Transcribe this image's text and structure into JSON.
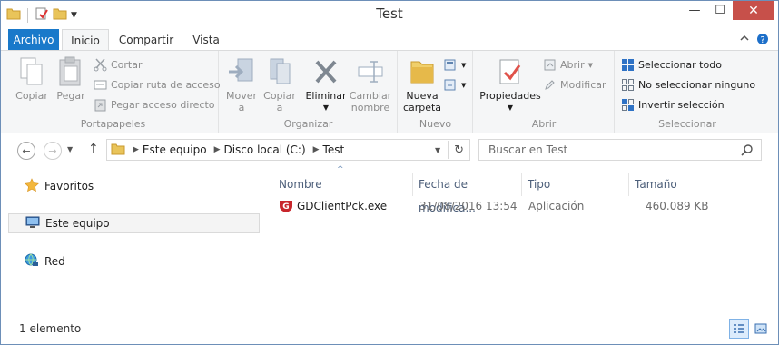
{
  "window": {
    "title": "Test"
  },
  "ribbon_tabs": [
    {
      "label": "Archivo"
    },
    {
      "label": "Inicio"
    },
    {
      "label": "Compartir"
    },
    {
      "label": "Vista"
    }
  ],
  "ribbon": {
    "portapapeles": {
      "label": "Portapapeles",
      "copiar": "Copiar",
      "pegar": "Pegar",
      "cortar": "Cortar",
      "copiar_ruta": "Copiar ruta de acceso",
      "pegar_acceso": "Pegar acceso directo"
    },
    "organizar": {
      "label": "Organizar",
      "mover_a": "Mover",
      "mover_a2": "a",
      "copiar_a": "Copiar",
      "copiar_a2": "a",
      "eliminar": "Eliminar",
      "cambiar": "Cambiar",
      "nombre": "nombre"
    },
    "nuevo": {
      "label": "Nuevo",
      "nueva": "Nueva",
      "carpeta": "carpeta"
    },
    "abrir": {
      "label": "Abrir",
      "propiedades": "Propiedades",
      "abrir": "Abrir",
      "modificar": "Modificar"
    },
    "seleccionar": {
      "label": "Seleccionar",
      "todo": "Seleccionar todo",
      "ninguno": "No seleccionar ninguno",
      "invertir": "Invertir selección"
    }
  },
  "address": {
    "crumbs": [
      "Este equipo",
      "Disco local (C:)",
      "Test"
    ]
  },
  "search": {
    "placeholder": "Buscar en Test"
  },
  "nav_pane": {
    "items": [
      {
        "label": "Favoritos"
      },
      {
        "label": "Este equipo"
      },
      {
        "label": "Red"
      }
    ]
  },
  "columns": {
    "name": "Nombre",
    "date": "Fecha de modifica...",
    "type": "Tipo",
    "size": "Tamaño"
  },
  "files": [
    {
      "name": "GDClientPck.exe",
      "date": "31/08/2016 13:54",
      "type": "Aplicación",
      "size": "460.089 KB"
    }
  ],
  "status": {
    "count": "1 elemento"
  },
  "colors": {
    "file_tab": "#1979ca",
    "close_button": "#c7504a",
    "column_header": "#4d5f7a"
  },
  "icons": [
    "folder-icon",
    "properties-icon",
    "new-folder-icon",
    "chevron-down-icon",
    "minimize-icon",
    "maximize-icon",
    "close-icon",
    "help-icon",
    "copy-icon",
    "paste-icon",
    "cut-icon",
    "move-to-icon",
    "copy-to-icon",
    "delete-icon",
    "rename-icon",
    "new-item-icon",
    "easy-access-icon",
    "open-icon",
    "edit-icon",
    "select-all-icon",
    "select-none-icon",
    "invert-selection-icon",
    "back-icon",
    "forward-icon",
    "up-icon",
    "refresh-icon",
    "search-icon",
    "star-icon",
    "computer-icon",
    "network-icon",
    "exe-shield-icon",
    "details-view-icon",
    "large-icons-view-icon"
  ]
}
